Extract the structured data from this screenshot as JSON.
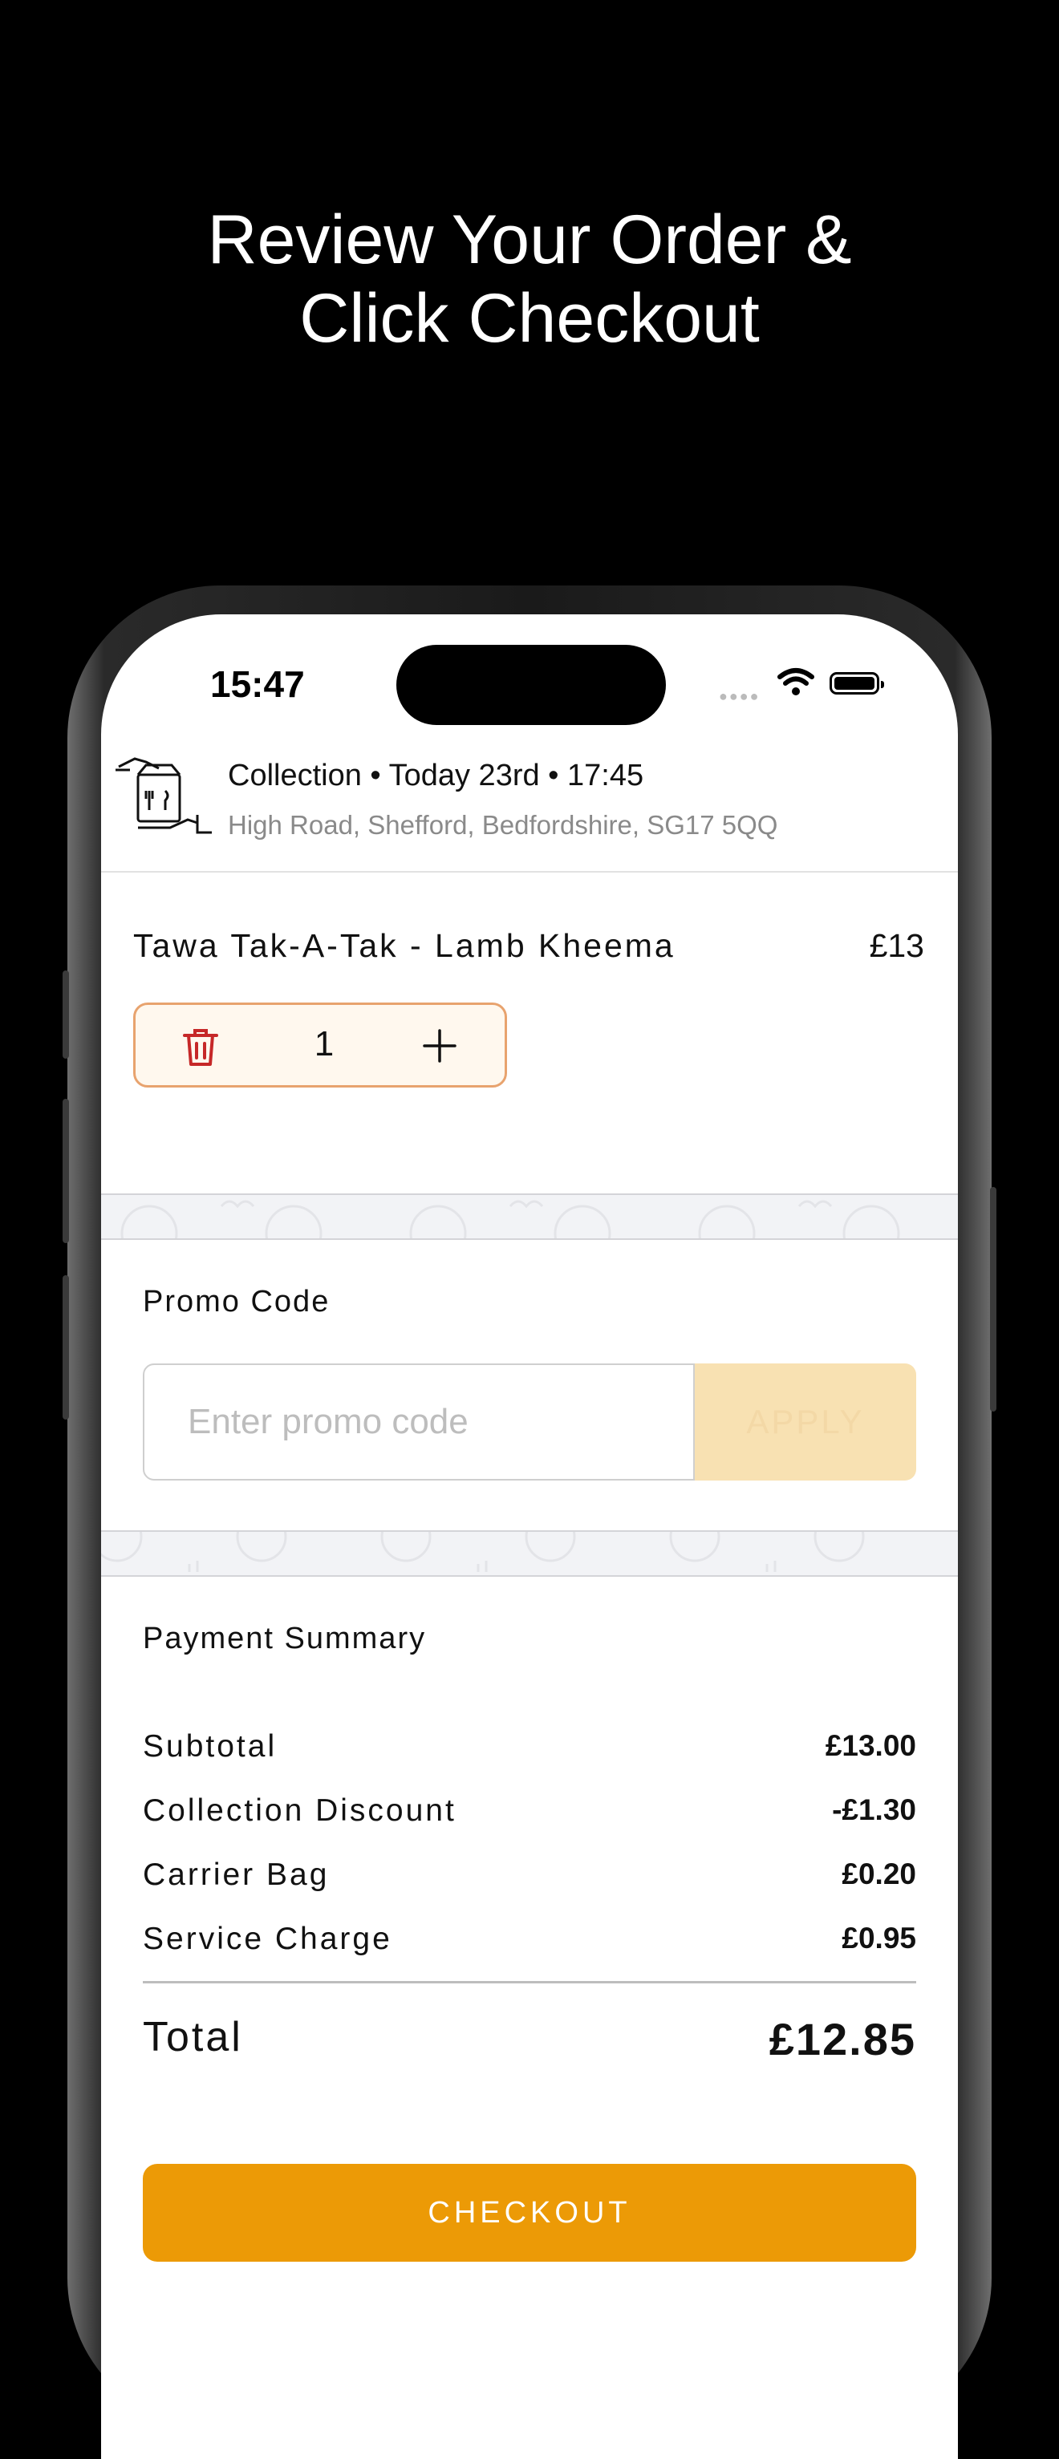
{
  "headline": {
    "line1": "Review Your Order &",
    "line2": "Click Checkout"
  },
  "status_bar": {
    "time": "15:47"
  },
  "order_info": {
    "line1": "Collection • Today 23rd • 17:45",
    "address": "High Road, Shefford, Bedfordshire, SG17  5QQ"
  },
  "cart": {
    "items": [
      {
        "name": "Tawa Tak-A-Tak - Lamb Kheema",
        "price": "£13",
        "quantity": "1"
      }
    ]
  },
  "promo": {
    "title": "Promo Code",
    "placeholder": "Enter promo code",
    "value": "",
    "apply_label": "APPLY"
  },
  "summary": {
    "title": "Payment Summary",
    "rows": [
      {
        "label": "Subtotal",
        "value": "£13.00"
      },
      {
        "label": "Collection Discount",
        "value": "-£1.30"
      },
      {
        "label": "Carrier Bag",
        "value": "£0.20"
      },
      {
        "label": "Service Charge",
        "value": "£0.95"
      }
    ],
    "total_label": "Total",
    "total_value": "£12.85"
  },
  "checkout_label": "CHECKOUT",
  "colors": {
    "accent": "#ec9a06",
    "apply_disabled": "#f8e1b2",
    "stepper_border": "#e8a36e",
    "trash_red": "#c62828"
  }
}
